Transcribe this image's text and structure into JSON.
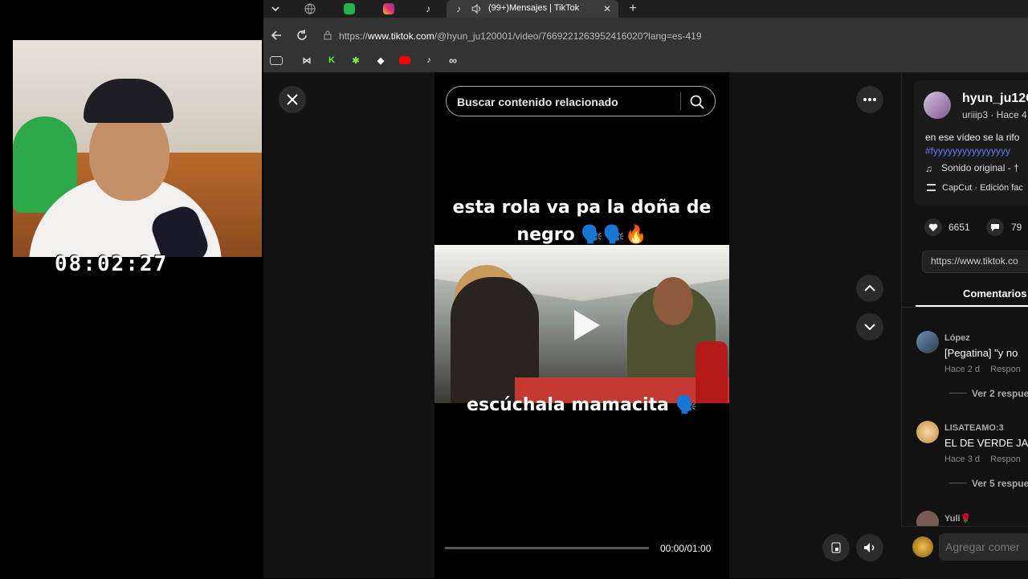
{
  "overlay": {
    "timer": "08:02:27"
  },
  "browser": {
    "active_tab_title": "(99+)Mensajes | TikTok",
    "url_prefix": "https://",
    "url_domain": "www.tiktok.com",
    "url_path": "/@hyun_ju120001/video/7669221263952416020?lang=es-419",
    "tab_icons": [
      "chevron-down-icon",
      "globe-icon",
      "badge-icon",
      "instagram-icon",
      "tiktok-icon"
    ],
    "bookmarks": [
      "bookmark-icon",
      "bowtie-icon",
      "kick-icon",
      "star-icon",
      "diamond-icon",
      "youtube-icon",
      "tiktok-icon",
      "infinity-icon"
    ]
  },
  "video": {
    "search_placeholder": "Buscar contenido relacionado",
    "caption_top_line1": "esta rola va pa la doña de",
    "caption_top_line2": "negro 🗣️🗣️🔥",
    "caption_bottom": "escúchala mamacita 🗣️",
    "time": "00:00/01:00",
    "progress": 0
  },
  "panel": {
    "author": "hyun_ju12C",
    "author_sub": "uriiip3 · Hace 4",
    "description": "en ese vídeo se la rifo",
    "hashtag": "#fyyyyyyyyyyyyyyyy",
    "sound": "Sonido original - †",
    "capcut": "CapCut · Edición fac",
    "likes": "6651",
    "comments_count": "79",
    "link": "https://www.tiktok.co",
    "tab_comments": "Comentarios",
    "comments": [
      {
        "user": "López",
        "text": "[Pegatina] \"y no",
        "time": "Hace 2 d",
        "reply": "Respon",
        "more": "Ver 2 respue"
      },
      {
        "user": "LISATEAMO:3",
        "text": "EL DE VERDE JA",
        "time": "Hace 3 d",
        "reply": "Respon",
        "more": "Ver 5 respue"
      },
      {
        "user": "Yuli🌹"
      }
    ],
    "add_comment_placeholder": "Agregar comer"
  },
  "colors": {
    "accent_hashtag": "#5b7cf0",
    "tab_bar": "#1f1f1f",
    "address_bar": "#333333",
    "panel_bg": "#121212"
  }
}
